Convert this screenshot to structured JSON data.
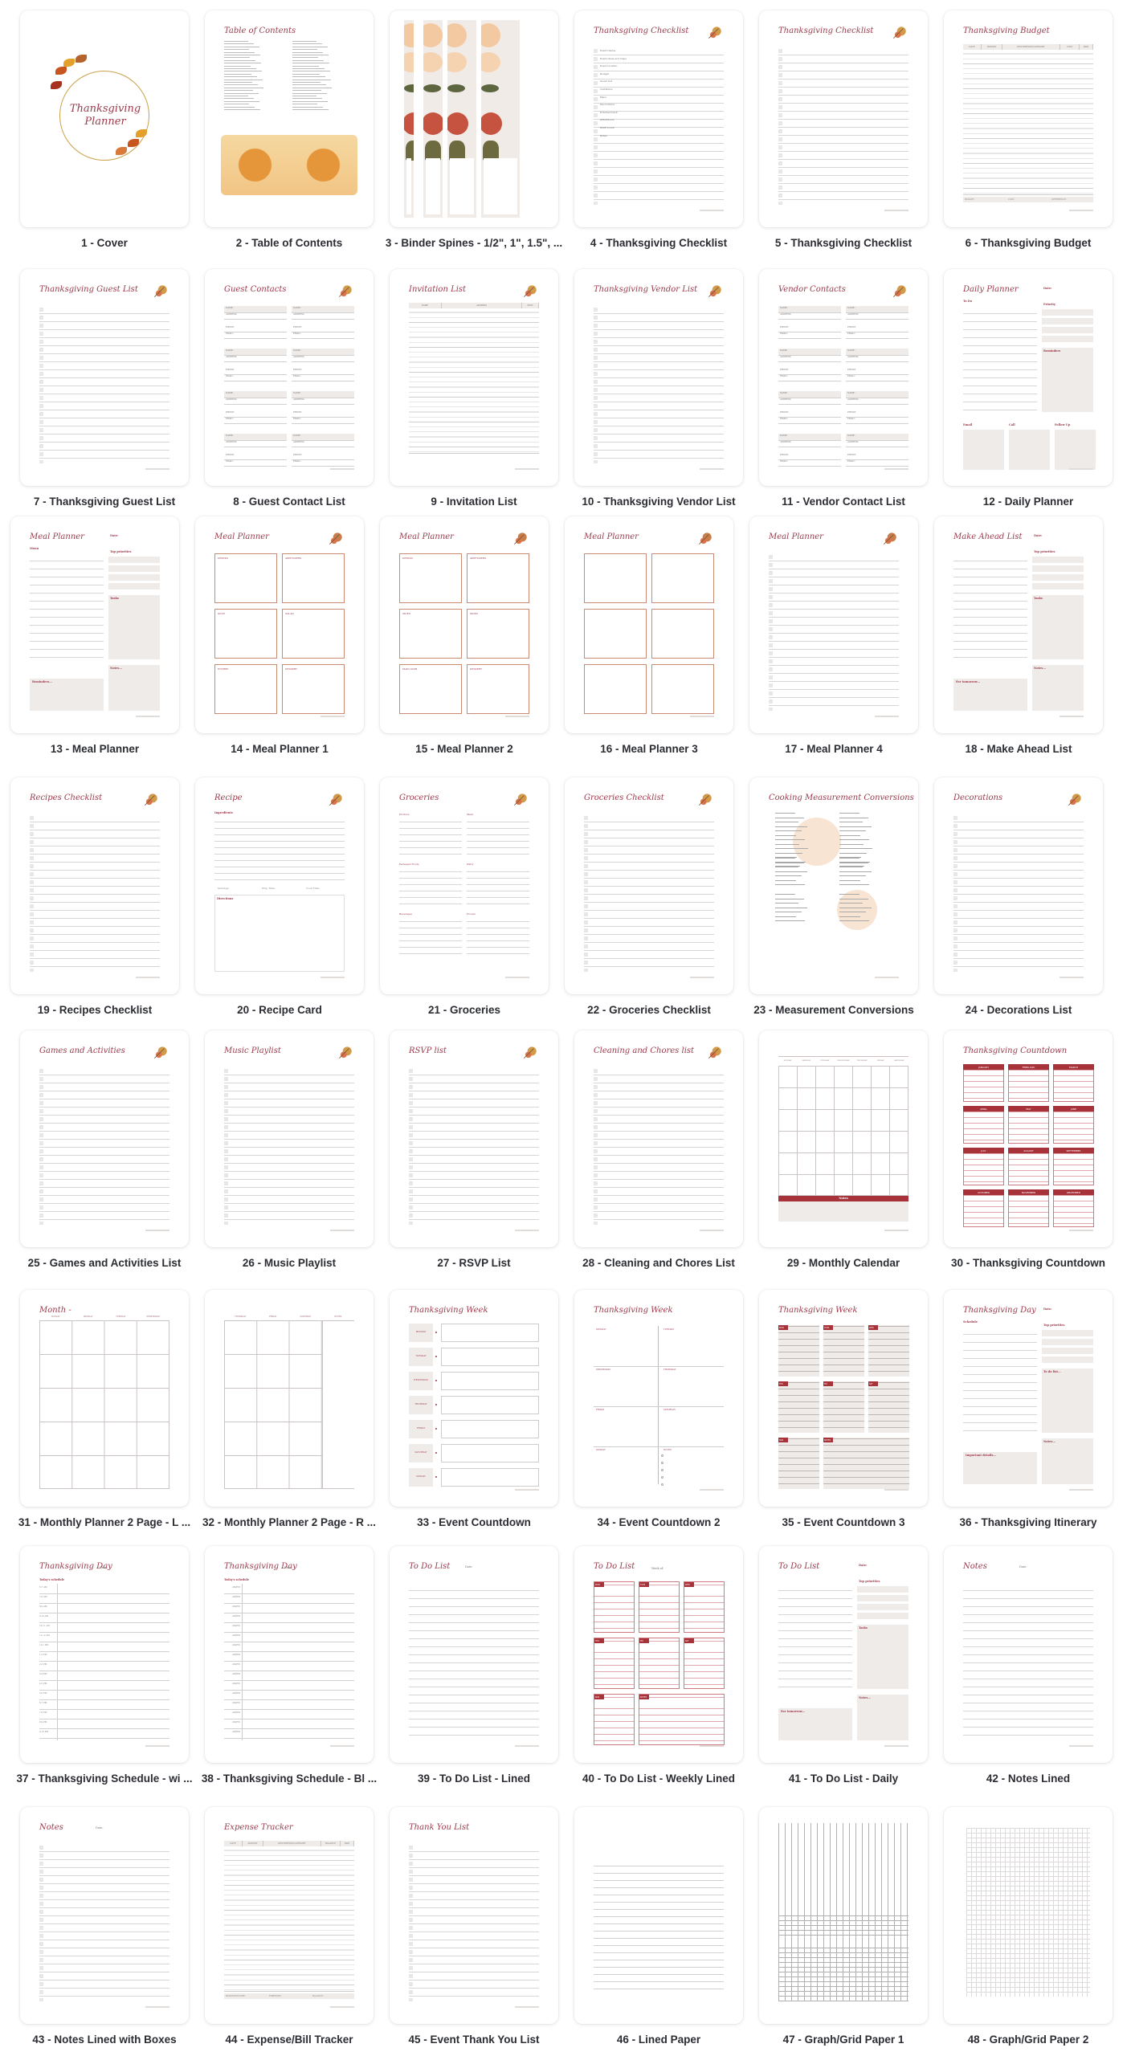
{
  "colors": {
    "accent_title": "#9b3a4b",
    "accent_red": "#a8323a",
    "label_text": "#2b2d33",
    "shade": "#efebe8",
    "box_border": "#c98a74"
  },
  "pages": [
    {
      "label": "1 - Cover",
      "title": "Thanksgiving Planner",
      "kind": "cover"
    },
    {
      "label": "2 - Table of Contents",
      "title": "Table of Contents",
      "kind": "toc"
    },
    {
      "label": "3 - Binder Spines - 1/2\", 1\", 1.5\", ...",
      "title": "",
      "kind": "spines"
    },
    {
      "label": "4 - Thanksgiving Checklist",
      "title": "Thanksgiving Checklist",
      "kind": "checklist",
      "items": [
        "Event theme",
        "Event ideas and Inspo",
        "Event location",
        "Budget",
        "Guest List",
        "Invitations",
        "Menu",
        "Decorations",
        "Entertainment",
        "Gifts/Favors",
        "RSVP Count",
        "Notes"
      ]
    },
    {
      "label": "5 - Thanksgiving Checklist",
      "title": "Thanksgiving Checklist",
      "kind": "boxes"
    },
    {
      "label": "6 - Thanksgiving Budget",
      "title": "Thanksgiving Budget",
      "kind": "table",
      "columns": [
        "DATE",
        "BUDGET",
        "DESCRIPTION/CATEGORY",
        "COST",
        "PAID"
      ],
      "footer": [
        "BUDGET:",
        "COST:",
        "DIFFERENCE:"
      ]
    },
    {
      "label": "7 - Thanksgiving Guest List",
      "title": "Thanksgiving Guest List",
      "kind": "boxes"
    },
    {
      "label": "8 - Guest Contact List",
      "title": "Guest Contacts",
      "kind": "contacts",
      "fields": [
        "NAME:",
        "ADDRESS:",
        "PHONE:",
        "EMAIL:"
      ]
    },
    {
      "label": "9 - Invitation List",
      "title": "Invitation List",
      "kind": "table",
      "columns": [
        "NAME",
        "ADDRESS",
        "SENT"
      ]
    },
    {
      "label": "10 - Thanksgiving Vendor List",
      "title": "Thanksgiving Vendor List",
      "kind": "boxes"
    },
    {
      "label": "11 - Vendor Contact List",
      "title": "Vendor Contacts",
      "kind": "contacts",
      "fields": [
        "NAME:",
        "ADDRESS:",
        "PHONE:",
        "EMAIL:"
      ]
    },
    {
      "label": "12 - Daily Planner",
      "title": "Daily Planner",
      "kind": "daily",
      "sections": [
        "To Do",
        "Date:",
        "Priority",
        "Reminders",
        "Email",
        "Call",
        "Follow Up"
      ]
    },
    {
      "label": "13 - Meal Planner",
      "title": "Meal Planner",
      "kind": "daily2",
      "sections": [
        "Menu",
        "Date:",
        "Top priorities",
        "Tasks",
        "Notes...",
        "Reminders..."
      ]
    },
    {
      "label": "14 - Meal Planner 1",
      "title": "Meal Planner",
      "kind": "six",
      "cells": [
        "DRINKS",
        "APPETIZERS",
        "SOUP",
        "SALAD",
        "ENTREE",
        "DESSERT"
      ]
    },
    {
      "label": "15 - Meal Planner 2",
      "title": "Meal Planner",
      "kind": "six",
      "cells": [
        "DRINKS",
        "APPETIZERS",
        "SIDES",
        "SIDES",
        "MAIN DISH",
        "DESSERT"
      ]
    },
    {
      "label": "16 - Meal Planner 3",
      "title": "Meal Planner",
      "kind": "six",
      "cells": [
        "",
        "",
        "",
        "",
        "",
        ""
      ]
    },
    {
      "label": "17 - Meal Planner 4",
      "title": "Meal Planner",
      "kind": "boxes"
    },
    {
      "label": "18 - Make Ahead List",
      "title": "Make Ahead List",
      "kind": "daily2",
      "sections": [
        "",
        "Date:",
        "Top priorities",
        "Tasks",
        "Notes...",
        "For tomorrow..."
      ]
    },
    {
      "label": "19 - Recipes Checklist",
      "title": "Recipes Checklist",
      "kind": "boxes"
    },
    {
      "label": "20 - Recipe Card",
      "title": "Recipe",
      "kind": "recipe",
      "sections": [
        "Ingredients",
        "Servings:",
        "Prep Time:",
        "Cook Time:",
        "Directions"
      ]
    },
    {
      "label": "21 - Groceries",
      "title": "Groceries",
      "kind": "groceries",
      "sections": [
        "Produce",
        "Meat",
        "Packaged Foods",
        "Dairy",
        "Beverages",
        "Frozen"
      ]
    },
    {
      "label": "22 - Groceries Checklist",
      "title": "Groceries Checklist",
      "kind": "boxes"
    },
    {
      "label": "23 - Measurement Conversions",
      "title": "Cooking Measurement Conversions",
      "kind": "conversions"
    },
    {
      "label": "24 - Decorations List",
      "title": "Decorations",
      "kind": "boxes"
    },
    {
      "label": "25 - Games and Activities List",
      "title": "Games and Activities",
      "kind": "boxes"
    },
    {
      "label": "26 - Music Playlist",
      "title": "Music Playlist",
      "kind": "boxes"
    },
    {
      "label": "27 - RSVP List",
      "title": "RSVP list",
      "kind": "boxes"
    },
    {
      "label": "28 - Cleaning and Chores List",
      "title": "Cleaning and Chores list",
      "kind": "boxes"
    },
    {
      "label": "29 - Monthly Calendar",
      "title": "",
      "kind": "calendar",
      "days": [
        "SUNDAY",
        "MONDAY",
        "TUESDAY",
        "WEDNESDAY",
        "THURSDAY",
        "FRIDAY",
        "SATURDAY"
      ],
      "notes": "Notes"
    },
    {
      "label": "30 - Thanksgiving Countdown",
      "title": "Thanksgiving Countdown",
      "kind": "months",
      "months": [
        "JANUARY",
        "FEBRUARY",
        "MARCH",
        "APRIL",
        "MAY",
        "JUNE",
        "JULY",
        "AUGUST",
        "SEPTEMBER",
        "OCTOBER",
        "NOVEMBER",
        "DECEMBER"
      ]
    },
    {
      "label": "31 - Monthly Planner 2 Page - L ...",
      "title": "Month -",
      "kind": "month4",
      "days": [
        "SUNDAY",
        "MONDAY",
        "TUESDAY",
        "WEDNESDAY"
      ]
    },
    {
      "label": "32 - Monthly Planner 2 Page - R ...",
      "title": "",
      "kind": "month4",
      "days": [
        "THURSDAY",
        "FRIDAY",
        "SATURDAY",
        "NOTES"
      ]
    },
    {
      "label": "33 - Event Countdown",
      "title": "Thanksgiving Week",
      "kind": "weekrows",
      "days": [
        "MONDAY",
        "TUESDAY",
        "WEDNESDAY",
        "THURSDAY",
        "FRIDAY",
        "SATURDAY",
        "SUNDAY"
      ]
    },
    {
      "label": "34 - Event Countdown 2",
      "title": "Thanksgiving Week",
      "kind": "weekgrid",
      "days": [
        "MONDAY",
        "TUESDAY",
        "WEDNESDAY",
        "THURSDAY",
        "FRIDAY",
        "SATURDAY",
        "SUNDAY",
        "NOTES"
      ]
    },
    {
      "label": "35 - Event Countdown 3",
      "title": "Thanksgiving Week",
      "kind": "weekblocks",
      "days": [
        "MON",
        "TUES",
        "WED",
        "THU",
        "FRI",
        "SAT",
        "SUN",
        "NOTES"
      ]
    },
    {
      "label": "36 - Thanksgiving Itinerary",
      "title": "Thanksgiving Day",
      "kind": "daily2",
      "sections": [
        "Schedule",
        "Date:",
        "Top priorities",
        "To do list...",
        "Notes...",
        "Important details..."
      ]
    },
    {
      "label": "37 - Thanksgiving Schedule - wi ...",
      "title": "Thanksgiving Day",
      "kind": "schedule",
      "date": "Date:",
      "subtitle": "Today's schedule",
      "times": [
        "6-7 AM",
        "7-8 AM",
        "8-9 AM",
        "9-10 AM",
        "10-11 AM",
        "11-12 AM",
        "12-1 PM",
        "1-2 PM",
        "2-3 PM",
        "3-4 PM",
        "4-5 PM",
        "5-6 PM",
        "6-7 PM",
        "7-8 PM",
        "8-9 PM",
        "9-10 PM"
      ]
    },
    {
      "label": "38 - Thanksgiving Schedule - Bl ...",
      "title": "Thanksgiving Day",
      "kind": "schedule",
      "date": "Date:",
      "subtitle": "Today's schedule",
      "times": [
        "AM/PM",
        "AM/PM",
        "AM/PM",
        "AM/PM",
        "AM/PM",
        "AM/PM",
        "AM/PM",
        "AM/PM",
        "AM/PM",
        "AM/PM",
        "AM/PM",
        "AM/PM",
        "AM/PM",
        "AM/PM",
        "AM/PM",
        "AM/PM"
      ]
    },
    {
      "label": "39 - To Do List - Lined",
      "title": "To Do List",
      "kind": "lined",
      "date": "Date:"
    },
    {
      "label": "40 - To Do List - Weekly Lined",
      "title": "To Do List",
      "kind": "weekblocks2",
      "date": "Week of:",
      "days": [
        "MON",
        "TUES",
        "WED",
        "THU",
        "FRI",
        "SAT",
        "SUN",
        "NOTES"
      ]
    },
    {
      "label": "41 - To Do List - Daily",
      "title": "To Do List",
      "kind": "daily2",
      "sections": [
        "",
        "Date:",
        "Top priorities",
        "Tasks",
        "Notes...",
        "For tomorrow..."
      ]
    },
    {
      "label": "42 - Notes Lined",
      "title": "Notes",
      "kind": "lined",
      "date": "Date:"
    },
    {
      "label": "43 - Notes Lined with Boxes",
      "title": "Notes",
      "kind": "boxes",
      "date": "Date:"
    },
    {
      "label": "44 - Expense/Bill Tracker",
      "title": "Expense Tracker",
      "kind": "table",
      "columns": [
        "DATE",
        "AMOUNT",
        "DESCRIPTION/CATEGORY",
        "BALANCE",
        "PAID"
      ],
      "footer": [
        "BUDGET/INCOME:",
        "EXPENSES:",
        "BALANCE:"
      ]
    },
    {
      "label": "45 - Event Thank You List",
      "title": "Thank You List",
      "kind": "boxes"
    },
    {
      "label": "46 - Lined Paper",
      "title": "",
      "kind": "plain-lined"
    },
    {
      "label": "47 - Graph/Grid Paper 1",
      "title": "",
      "kind": "grid1"
    },
    {
      "label": "48 - Graph/Grid Paper 2",
      "title": "",
      "kind": "grid2"
    }
  ]
}
